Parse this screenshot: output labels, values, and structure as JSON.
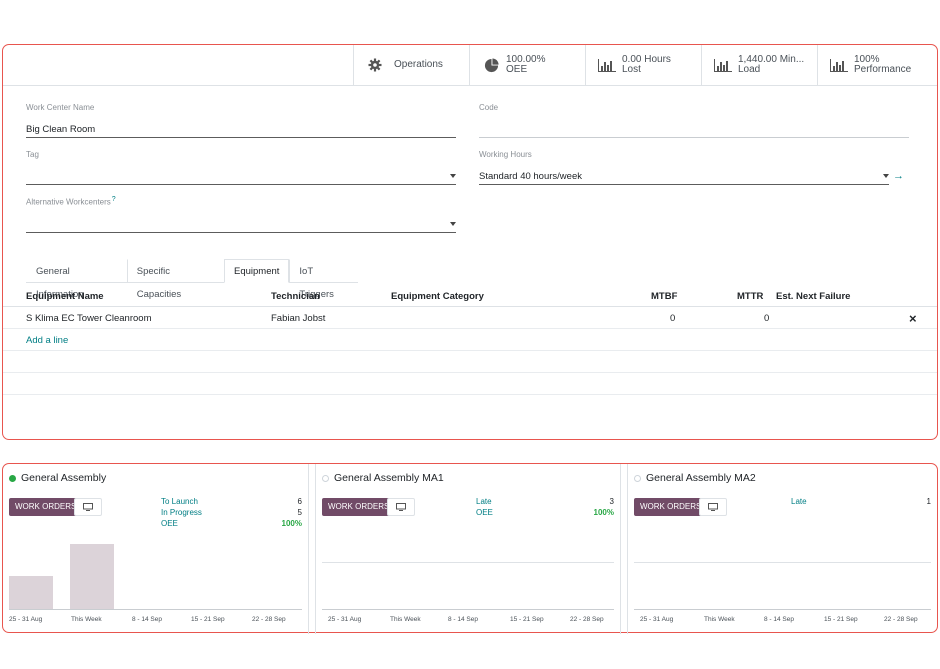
{
  "smart_buttons": [
    {
      "icon": "gear-icon",
      "line1": "Operations",
      "line2": ""
    },
    {
      "icon": "pie-chart-icon",
      "line1": "100.00%",
      "line2": "OEE"
    },
    {
      "icon": "bar-chart-icon",
      "line1": "0.00 Hours",
      "line2": "Lost"
    },
    {
      "icon": "bar-chart-icon",
      "line1": "1,440.00 Min...",
      "line2": "Load"
    },
    {
      "icon": "bar-chart-icon",
      "line1": "100%",
      "line2": "Performance"
    }
  ],
  "form": {
    "work_center_name_label": "Work Center Name",
    "work_center_name_value": "Big Clean Room",
    "code_label": "Code",
    "code_value": "",
    "tag_label": "Tag",
    "tag_value": "",
    "working_hours_label": "Working Hours",
    "working_hours_value": "Standard 40 hours/week",
    "alt_workcenters_label": "Alternative Workcenters",
    "alt_workcenters_help": "?"
  },
  "tabs": [
    {
      "label": "General Information",
      "active": false
    },
    {
      "label": "Specific Capacities",
      "active": false
    },
    {
      "label": "Equipment",
      "active": true
    },
    {
      "label": "IoT Triggers",
      "active": false
    }
  ],
  "equipment_table": {
    "headers": [
      "Equipment Name",
      "Technician",
      "Equipment Category",
      "MTBF",
      "MTTR",
      "Est. Next Failure"
    ],
    "rows": [
      {
        "name": "S Klima EC Tower Cleanroom",
        "technician": "Fabian Jobst",
        "category": "",
        "mtbf": "0",
        "mttr": "0",
        "next_failure": ""
      }
    ],
    "add_line": "Add a line",
    "delete_icon": "×"
  },
  "kanban": [
    {
      "title": "General Assembly",
      "status_color": "#28a745",
      "work_orders_label": "WORK ORDERS",
      "stats": [
        {
          "label": "To Launch",
          "value": "6"
        },
        {
          "label": "In Progress",
          "value": "5"
        },
        {
          "label": "OEE",
          "value": "100%",
          "green": true
        }
      ],
      "x_labels": [
        "25 - 31 Aug",
        "This Week",
        "8 - 14 Sep",
        "15 - 21 Sep",
        "22 - 28 Sep"
      ],
      "bar_values": [
        0.5,
        1.0,
        0,
        0,
        0
      ]
    },
    {
      "title": "General Assembly MA1",
      "status_color": "#ced4da",
      "work_orders_label": "WORK ORDERS",
      "stats": [
        {
          "label": "Late",
          "value": "3"
        },
        {
          "label": "OEE",
          "value": "100%",
          "green": true
        }
      ],
      "x_labels": [
        "25 - 31 Aug",
        "This Week",
        "8 - 14 Sep",
        "15 - 21 Sep",
        "22 - 28 Sep"
      ],
      "bar_values": [
        0,
        0,
        0,
        0,
        0
      ]
    },
    {
      "title": "General Assembly MA2",
      "status_color": "#ced4da",
      "work_orders_label": "WORK ORDERS",
      "stats": [
        {
          "label": "Late",
          "value": "1"
        }
      ],
      "x_labels": [
        "25 - 31 Aug",
        "This Week",
        "8 - 14 Sep",
        "15 - 21 Sep",
        "22 - 28 Sep"
      ],
      "bar_values": [
        0,
        0,
        0,
        0,
        0
      ]
    }
  ],
  "colors": {
    "accent": "#017e84",
    "primary": "#714b67",
    "highlight_border": "#e8554e"
  }
}
